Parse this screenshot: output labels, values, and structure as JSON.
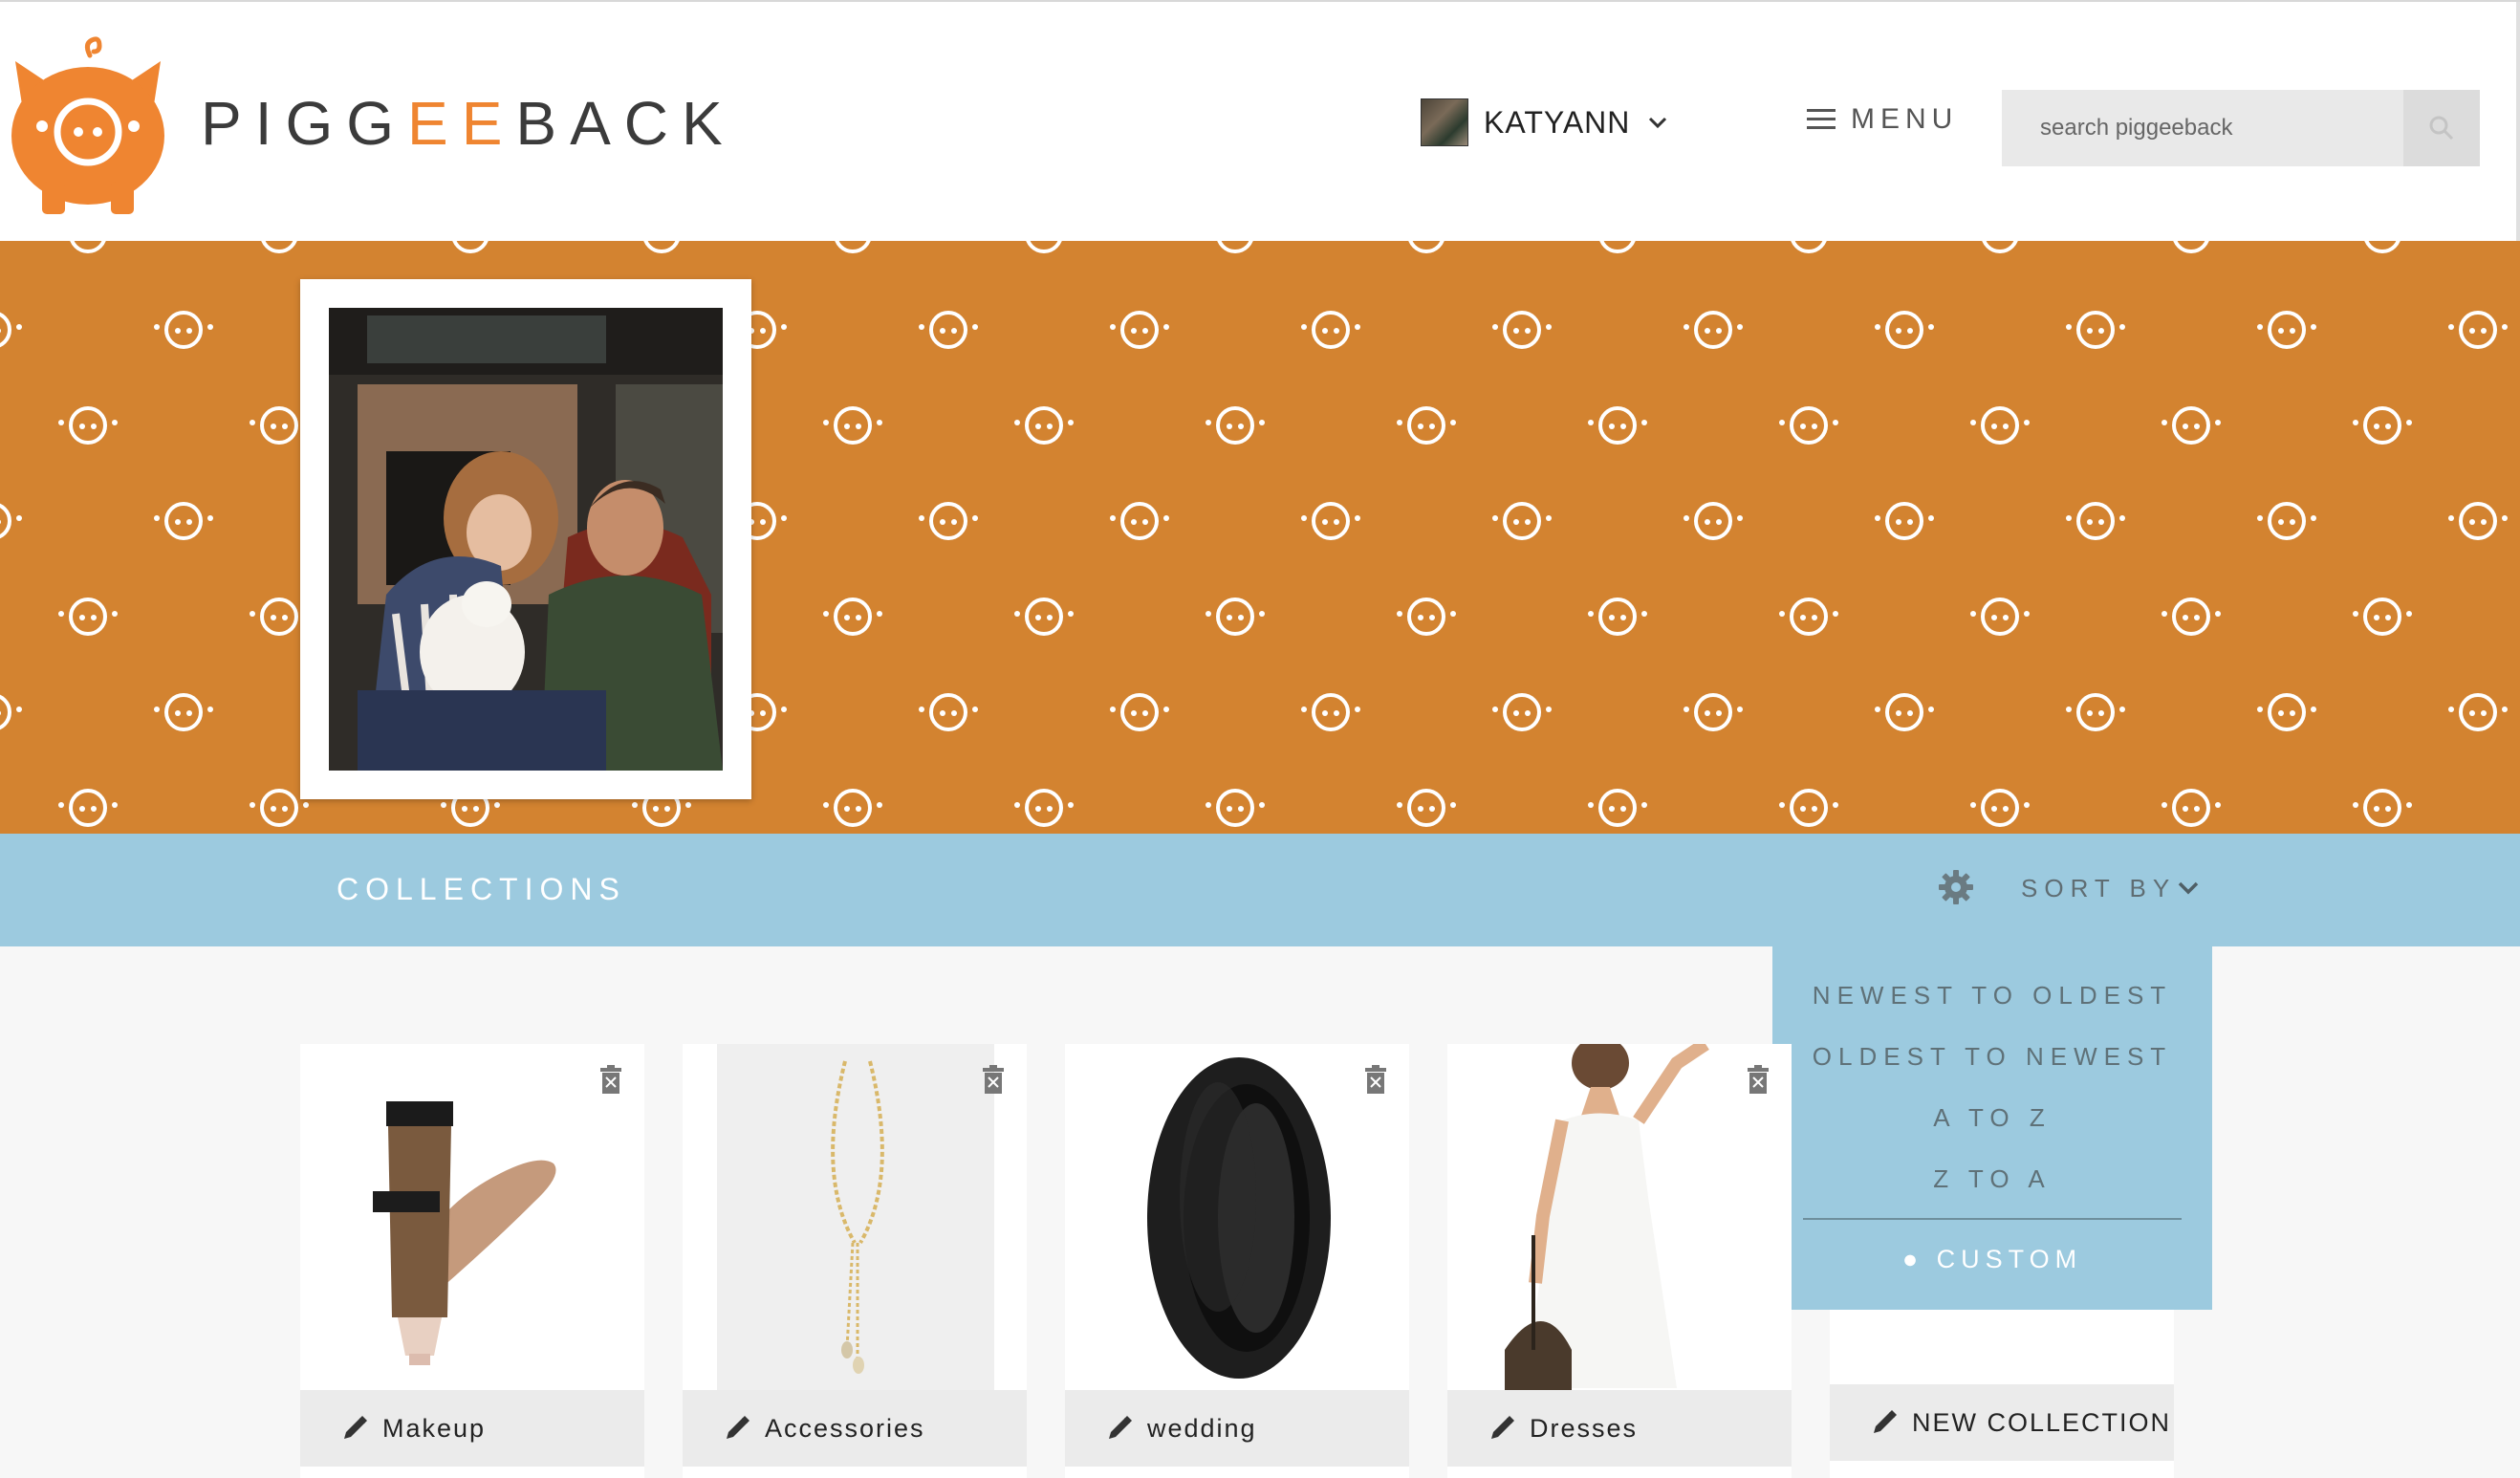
{
  "header": {
    "logo_prefix": "PIGG",
    "logo_accent": "EE",
    "logo_suffix": "BACK",
    "user_name": "KATYANN",
    "menu_label": "MENU",
    "search_placeholder": "search piggeeback"
  },
  "collections_bar": {
    "title": "COLLECTIONS",
    "sort_label": "SORT BY"
  },
  "sort_dropdown": {
    "options": [
      "NEWEST TO OLDEST",
      "OLDEST TO NEWEST",
      "A TO Z",
      "Z TO A"
    ],
    "selected": "CUSTOM"
  },
  "collections": [
    {
      "label": "Makeup"
    },
    {
      "label": "Accessories"
    },
    {
      "label": "wedding"
    },
    {
      "label": "Dresses"
    }
  ],
  "new_collection_label": "NEW COLLECTION",
  "colors": {
    "brand_orange": "#ef8531",
    "banner_orange": "#d38330",
    "collections_blue": "#9ccadf"
  },
  "icons": [
    "pig-logo-icon",
    "chevron-down-icon",
    "hamburger-icon",
    "search-icon",
    "gear-icon",
    "trash-icon",
    "pencil-icon"
  ]
}
